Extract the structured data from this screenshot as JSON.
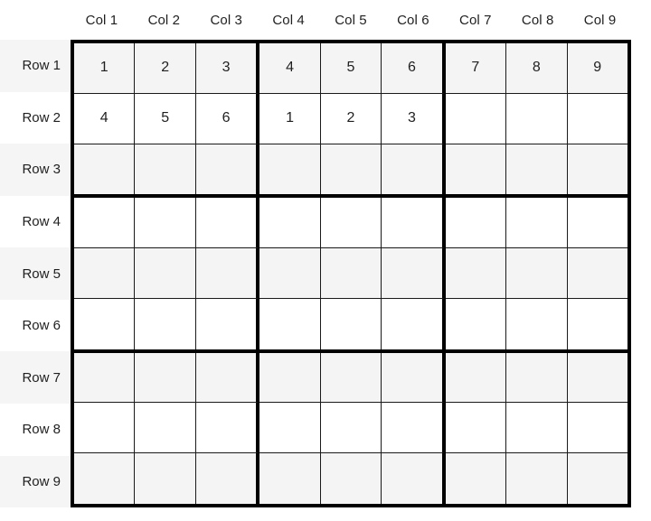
{
  "grid": {
    "size": 9,
    "box_size": 3,
    "column_headers": [
      "Col 1",
      "Col 2",
      "Col 3",
      "Col 4",
      "Col 5",
      "Col 6",
      "Col 7",
      "Col 8",
      "Col 9"
    ],
    "row_headers": [
      "Row 1",
      "Row 2",
      "Row 3",
      "Row 4",
      "Row 5",
      "Row 6",
      "Row 7",
      "Row 8",
      "Row 9"
    ],
    "cells": [
      [
        "1",
        "2",
        "3",
        "4",
        "5",
        "6",
        "7",
        "8",
        "9"
      ],
      [
        "4",
        "5",
        "6",
        "1",
        "2",
        "3",
        "",
        "",
        ""
      ],
      [
        "",
        "",
        "",
        "",
        "",
        "",
        "",
        "",
        ""
      ],
      [
        "",
        "",
        "",
        "",
        "",
        "",
        "",
        "",
        ""
      ],
      [
        "",
        "",
        "",
        "",
        "",
        "",
        "",
        "",
        ""
      ],
      [
        "",
        "",
        "",
        "",
        "",
        "",
        "",
        "",
        ""
      ],
      [
        "",
        "",
        "",
        "",
        "",
        "",
        "",
        "",
        ""
      ],
      [
        "",
        "",
        "",
        "",
        "",
        "",
        "",
        "",
        ""
      ],
      [
        "",
        "",
        "",
        "",
        "",
        "",
        "",
        "",
        ""
      ]
    ],
    "colors": {
      "page_background": "#ffffff",
      "cell_background": "#ffffff",
      "striped_background": "#f4f4f4",
      "row_label_striped_background": "#f5f5f5",
      "thin_border": "#1a1a1a",
      "thick_border": "#000000",
      "text": "#1f1f1f"
    }
  }
}
